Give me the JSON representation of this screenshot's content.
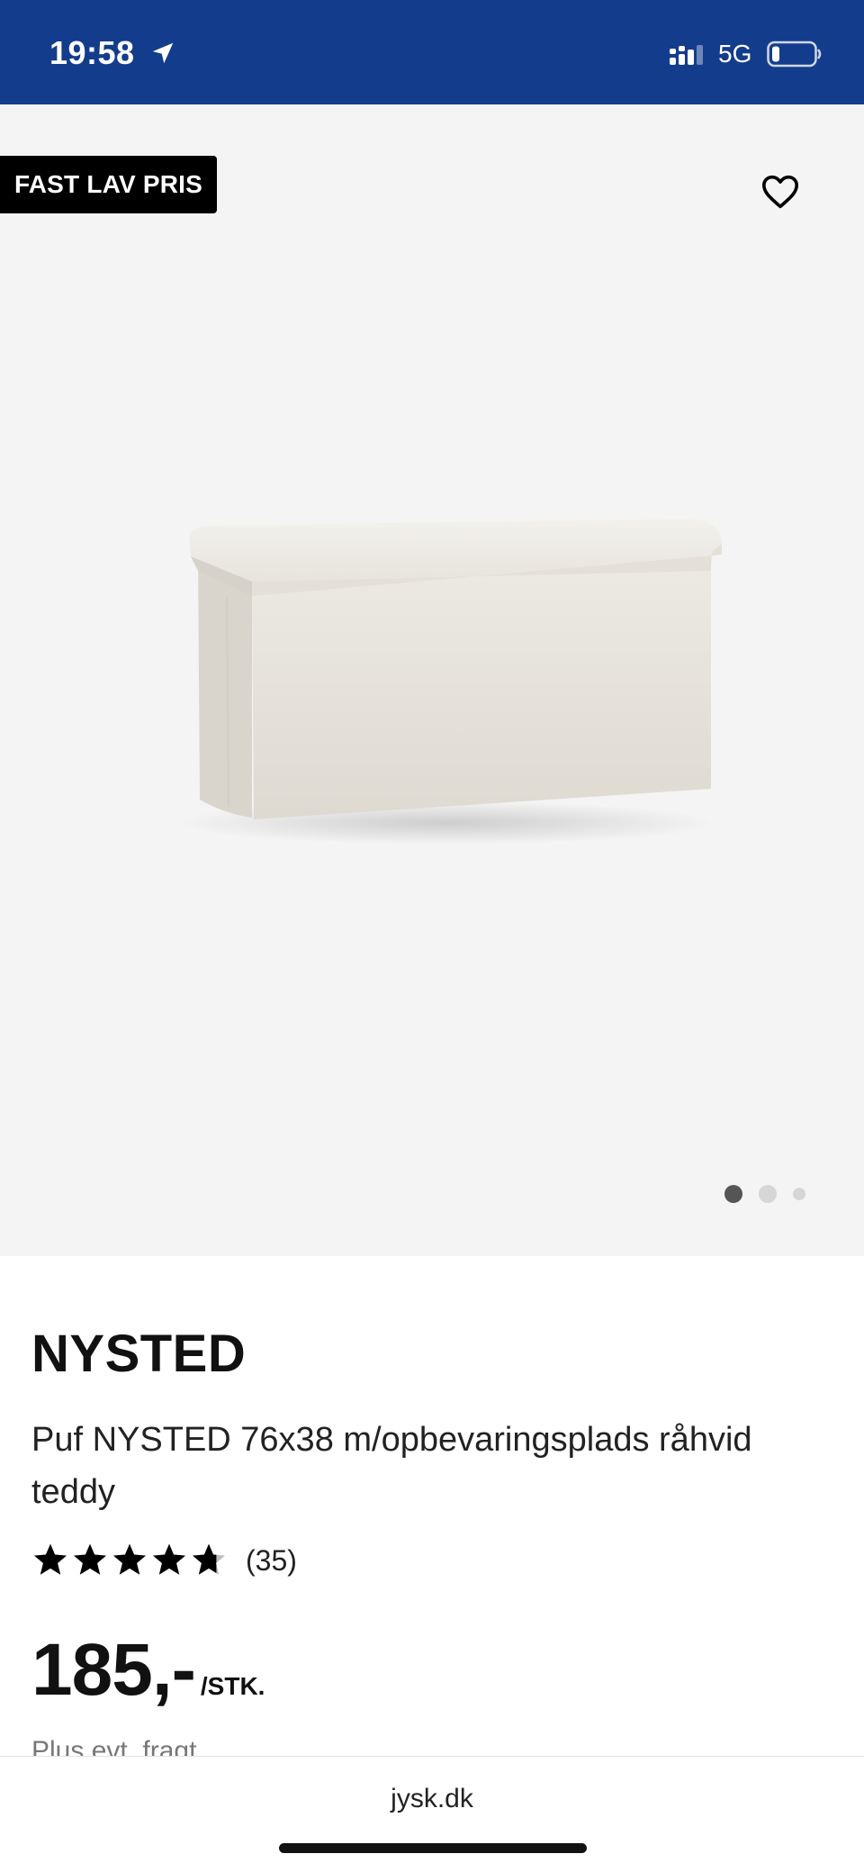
{
  "status_bar": {
    "time": "19:58",
    "network": "5G",
    "icons": [
      "location-arrow-icon",
      "cellular-signal-icon",
      "battery-icon"
    ]
  },
  "gallery": {
    "badge": "FAST LAV PRIS",
    "favorite_icon": "heart-icon",
    "slide_count": 3,
    "active_slide": 1
  },
  "product": {
    "brand": "NYSTED",
    "name": "Puf NYSTED 76x38 m/opbevaringsplads råhvid teddy",
    "rating": 4.7,
    "rating_max": 5,
    "review_count": "(35)",
    "price": "185,-",
    "unit": "/STK.",
    "shipping_note": "Plus evt. fragt"
  },
  "browser": {
    "url": "jysk.dk"
  },
  "colors": {
    "status_bar": "#143c8c",
    "gallery_bg": "#f4f4f4",
    "badge_bg": "#000000"
  }
}
